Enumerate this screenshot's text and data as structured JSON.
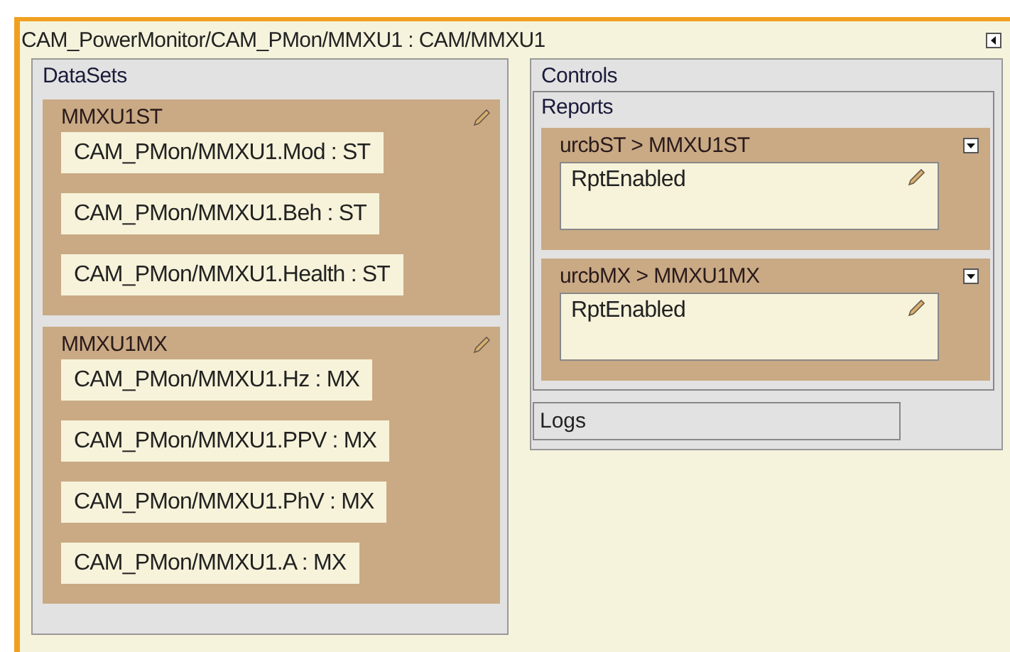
{
  "title": "CAM_PowerMonitor/CAM_PMon/MMXU1 : CAM/MMXU1",
  "datasets": {
    "label": "DataSets",
    "groups": [
      {
        "name": "MMXU1ST",
        "items": [
          "CAM_PMon/MMXU1.Mod : ST",
          "CAM_PMon/MMXU1.Beh : ST",
          "CAM_PMon/MMXU1.Health : ST"
        ]
      },
      {
        "name": "MMXU1MX",
        "items": [
          "CAM_PMon/MMXU1.Hz : MX",
          "CAM_PMon/MMXU1.PPV : MX",
          "CAM_PMon/MMXU1.PhV : MX",
          "CAM_PMon/MMXU1.A : MX"
        ]
      }
    ]
  },
  "controls": {
    "label": "Controls",
    "reports": {
      "label": "Reports",
      "items": [
        {
          "title": "urcbST > MMXU1ST",
          "fields": [
            "RptEnabled"
          ]
        },
        {
          "title": "urcbMX > MMXU1MX",
          "fields": [
            "RptEnabled"
          ]
        }
      ]
    },
    "logs": {
      "label": "Logs"
    }
  }
}
